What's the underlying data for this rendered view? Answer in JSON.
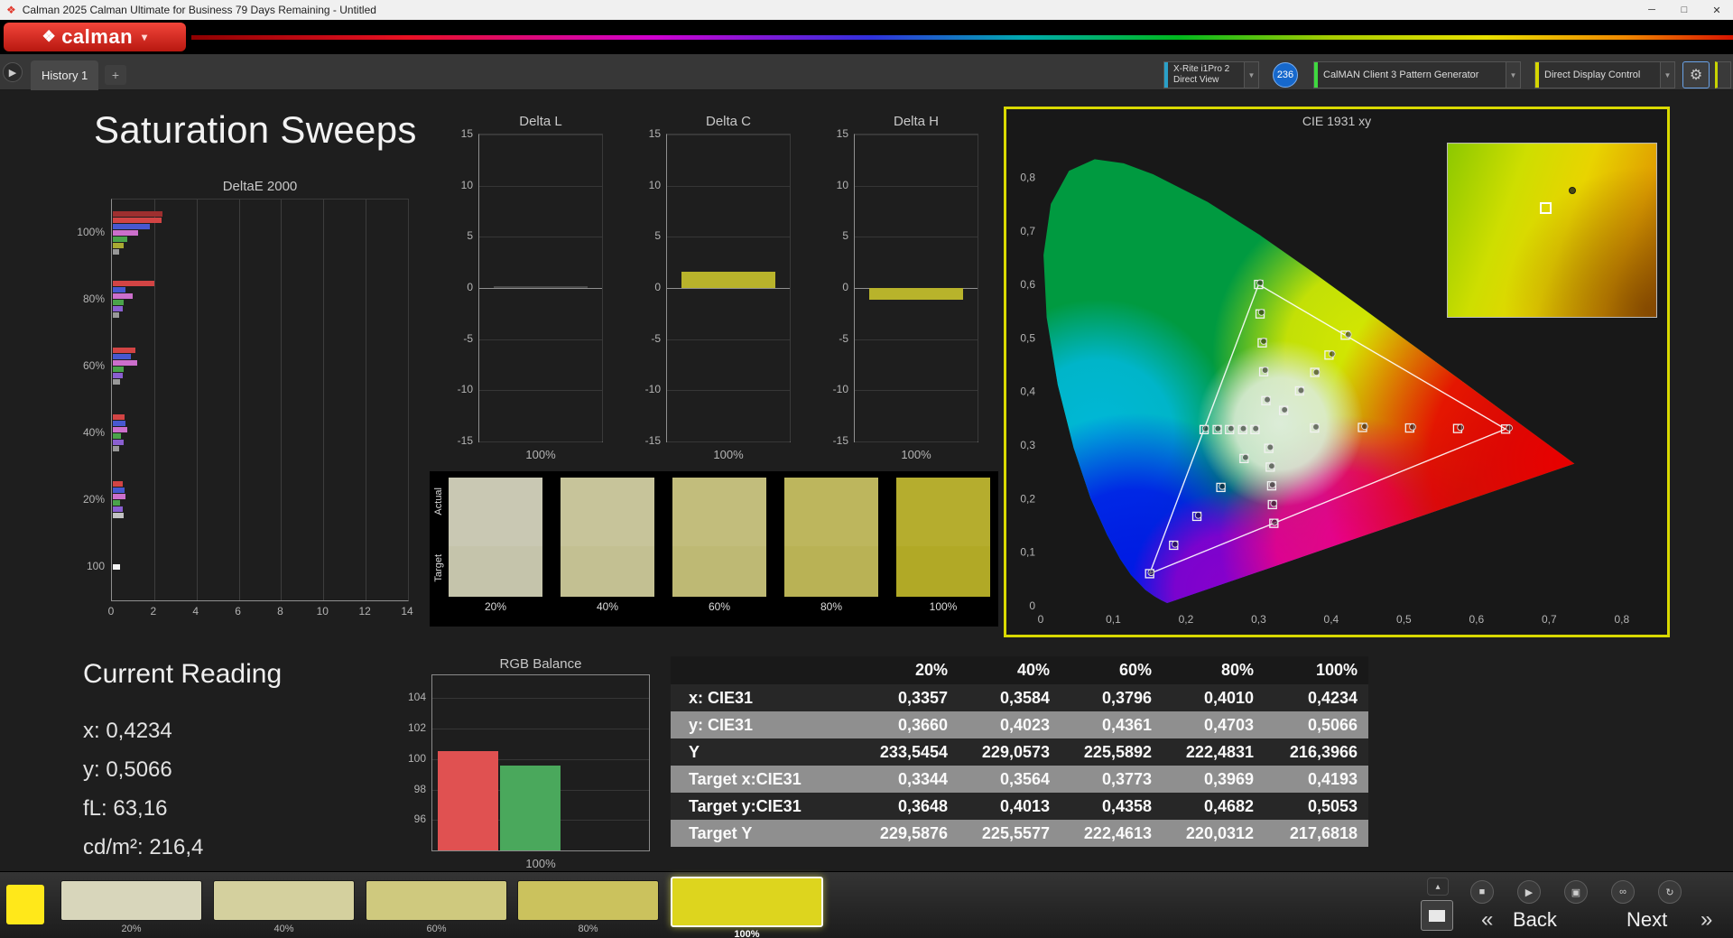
{
  "window": {
    "title": "Calman 2025 Calman Ultimate for Business 79 Days Remaining  - Untitled",
    "controls": {
      "minimize": "─",
      "maximize": "□",
      "close": "✕"
    }
  },
  "brand": {
    "logo_text": "calman",
    "logo_mark": "❖"
  },
  "tab_bar": {
    "tabs": [
      {
        "label": "History 1"
      }
    ],
    "add_label": "+",
    "scroll_label": "▶",
    "meter_dropdown": {
      "line1": "X-Rite i1Pro 2",
      "line2": "Direct View"
    },
    "badge": "236",
    "source_dropdown": "CalMAN Client 3 Pattern Generator",
    "display_dropdown": "Direct Display Control",
    "gear_label": "⚙"
  },
  "page": {
    "title": "Saturation Sweeps"
  },
  "current_reading": {
    "title": "Current Reading",
    "x": "x: 0,4234",
    "y": "y: 0,5066",
    "fl": "fL: 63,16",
    "cdm2": "cd/m²: 216,4"
  },
  "swatch_panel": {
    "row_labels": [
      "Actual",
      "Target"
    ],
    "columns": [
      {
        "label": "20%",
        "actual": "#c9c8b3",
        "target": "#c5c4ab"
      },
      {
        "label": "40%",
        "actual": "#c7c49a",
        "target": "#c3c092"
      },
      {
        "label": "60%",
        "actual": "#c2bd7c",
        "target": "#beb974"
      },
      {
        "label": "80%",
        "actual": "#bdb65d",
        "target": "#b9b255"
      },
      {
        "label": "100%",
        "actual": "#b5ad2e",
        "target": "#b1a926"
      }
    ]
  },
  "table": {
    "headers": [
      "",
      "20%",
      "40%",
      "60%",
      "80%",
      "100%"
    ],
    "rows": [
      {
        "label": "x: CIE31",
        "values": [
          "0,3357",
          "0,3584",
          "0,3796",
          "0,4010",
          "0,4234"
        ]
      },
      {
        "label": "y: CIE31",
        "values": [
          "0,3660",
          "0,4023",
          "0,4361",
          "0,4703",
          "0,5066"
        ]
      },
      {
        "label": "Y",
        "values": [
          "233,5454",
          "229,0573",
          "225,5892",
          "222,4831",
          "216,3966"
        ]
      },
      {
        "label": "Target x:CIE31",
        "values": [
          "0,3344",
          "0,3564",
          "0,3773",
          "0,3969",
          "0,4193"
        ]
      },
      {
        "label": "Target y:CIE31",
        "values": [
          "0,3648",
          "0,4013",
          "0,4358",
          "0,4682",
          "0,5053"
        ]
      },
      {
        "label": "Target Y",
        "values": [
          "229,5876",
          "225,5577",
          "222,4613",
          "220,0312",
          "217,6818"
        ]
      }
    ]
  },
  "bottom_bar": {
    "preview_color": "#ffe81a",
    "swatches": [
      {
        "label": "20%",
        "color": "#d8d6bb",
        "selected": false
      },
      {
        "label": "40%",
        "color": "#d4d09e",
        "selected": false
      },
      {
        "label": "60%",
        "color": "#cfc97e",
        "selected": false
      },
      {
        "label": "80%",
        "color": "#cbc25d",
        "selected": false
      },
      {
        "label": "100%",
        "color": "#ddd51e",
        "selected": true
      }
    ],
    "transport": {
      "eject": "▴",
      "stop": "■",
      "play": "▶",
      "save": "▣",
      "link": "∞",
      "refresh": "↻"
    },
    "back_chevron": "«",
    "back_label": "Back",
    "next_label": "Next",
    "next_chevron": "»"
  },
  "chart_data": [
    {
      "id": "delta_e",
      "type": "bar",
      "orientation": "horizontal",
      "title": "DeltaE 2000",
      "xlim": [
        0,
        14
      ],
      "x_ticks": [
        0,
        2,
        4,
        6,
        8,
        10,
        12,
        14
      ],
      "groups": [
        {
          "label": "100%",
          "bars": [
            {
              "c": "#9e2f2f",
              "v": 2.35
            },
            {
              "c": "#d24444",
              "v": 2.3
            },
            {
              "c": "#4758d0",
              "v": 1.75
            },
            {
              "c": "#cc6fcc",
              "v": 1.2
            },
            {
              "c": "#4aa34a",
              "v": 0.7
            },
            {
              "c": "#a9a932",
              "v": 0.5
            },
            {
              "c": "#989898",
              "v": 0.3
            }
          ]
        },
        {
          "label": "80%",
          "bars": [
            {
              "c": "#d24444",
              "v": 1.95
            },
            {
              "c": "#4758d0",
              "v": 0.6
            },
            {
              "c": "#cc6fcc",
              "v": 0.95
            },
            {
              "c": "#4aa34a",
              "v": 0.5
            },
            {
              "c": "#8a5fd0",
              "v": 0.45
            },
            {
              "c": "#989898",
              "v": 0.3
            }
          ]
        },
        {
          "label": "60%",
          "bars": [
            {
              "c": "#d24444",
              "v": 1.05
            },
            {
              "c": "#4758d0",
              "v": 0.85
            },
            {
              "c": "#cc6fcc",
              "v": 1.15
            },
            {
              "c": "#4aa34a",
              "v": 0.5
            },
            {
              "c": "#8a5fd0",
              "v": 0.45
            },
            {
              "c": "#989898",
              "v": 0.35
            }
          ]
        },
        {
          "label": "40%",
          "bars": [
            {
              "c": "#d24444",
              "v": 0.55
            },
            {
              "c": "#4758d0",
              "v": 0.6
            },
            {
              "c": "#cc6fcc",
              "v": 0.7
            },
            {
              "c": "#4aa34a",
              "v": 0.4
            },
            {
              "c": "#8a5fd0",
              "v": 0.5
            },
            {
              "c": "#989898",
              "v": 0.3
            }
          ]
        },
        {
          "label": "20%",
          "bars": [
            {
              "c": "#d24444",
              "v": 0.45
            },
            {
              "c": "#4758d0",
              "v": 0.55
            },
            {
              "c": "#cc6fcc",
              "v": 0.6
            },
            {
              "c": "#4aa34a",
              "v": 0.35
            },
            {
              "c": "#8a5fd0",
              "v": 0.45
            },
            {
              "c": "#c2c2c2",
              "v": 0.5
            }
          ]
        },
        {
          "label": "100",
          "bars": [
            {
              "c": "#f5f5f5",
              "v": 0.35
            }
          ]
        }
      ]
    },
    {
      "id": "delta_l",
      "type": "bar",
      "title": "Delta L",
      "ylim": [
        -15,
        15
      ],
      "y_ticks": [
        15,
        10,
        5,
        0,
        -5,
        -10,
        -15
      ],
      "xlabel": "100%",
      "value": 0.15,
      "color": "#4a4a4a"
    },
    {
      "id": "delta_c",
      "type": "bar",
      "title": "Delta C",
      "ylim": [
        -15,
        15
      ],
      "y_ticks": [
        15,
        10,
        5,
        0,
        -5,
        -10,
        -15
      ],
      "xlabel": "100%",
      "value": 1.6,
      "color": "#b8b32b"
    },
    {
      "id": "delta_h",
      "type": "bar",
      "title": "Delta H",
      "ylim": [
        -15,
        15
      ],
      "y_ticks": [
        15,
        10,
        5,
        0,
        -5,
        -10,
        -15
      ],
      "xlabel": "100%",
      "value": -1.15,
      "color": "#b8b32b"
    },
    {
      "id": "rgb_balance",
      "type": "bar",
      "title": "RGB Balance",
      "ylim": [
        94,
        105.5
      ],
      "y_ticks": [
        104,
        102,
        100,
        98,
        96
      ],
      "xlabel": "100%",
      "series": [
        {
          "name": "Red",
          "color": "#e05151",
          "value": 100.55
        },
        {
          "name": "Green",
          "color": "#4aa85c",
          "value": 99.6
        }
      ]
    },
    {
      "id": "cie",
      "type": "scatter",
      "title": "CIE 1931 xy",
      "xlim": [
        0,
        0.84
      ],
      "ylim": [
        0,
        0.88
      ],
      "x_ticks": [
        "0",
        "0,1",
        "0,2",
        "0,3",
        "0,4",
        "0,5",
        "0,6",
        "0,7",
        "0,8"
      ],
      "y_ticks": [
        "0,8",
        "0,7",
        "0,6",
        "0,5",
        "0,4",
        "0,3",
        "0,2",
        "0,1",
        "0"
      ],
      "gamut_triangle": [
        [
          0.64,
          0.33
        ],
        [
          0.3,
          0.6
        ],
        [
          0.15,
          0.06
        ]
      ],
      "targets": [
        [
          0.377,
          0.332
        ],
        [
          0.443,
          0.333
        ],
        [
          0.508,
          0.332
        ],
        [
          0.574,
          0.331
        ],
        [
          0.64,
          0.33
        ],
        [
          0.31,
          0.383
        ],
        [
          0.307,
          0.437
        ],
        [
          0.305,
          0.491
        ],
        [
          0.302,
          0.545
        ],
        [
          0.3,
          0.6
        ],
        [
          0.28,
          0.275
        ],
        [
          0.248,
          0.221
        ],
        [
          0.215,
          0.167
        ],
        [
          0.183,
          0.113
        ],
        [
          0.15,
          0.06
        ],
        [
          0.3344,
          0.3648
        ],
        [
          0.3564,
          0.4013
        ],
        [
          0.3773,
          0.4358
        ],
        [
          0.3969,
          0.4682
        ],
        [
          0.4193,
          0.5053
        ],
        [
          0.295,
          0.329
        ],
        [
          0.278,
          0.329
        ],
        [
          0.26,
          0.329
        ],
        [
          0.243,
          0.329
        ],
        [
          0.225,
          0.329
        ],
        [
          0.314,
          0.294
        ],
        [
          0.316,
          0.259
        ],
        [
          0.318,
          0.224
        ],
        [
          0.319,
          0.189
        ],
        [
          0.321,
          0.154
        ]
      ],
      "measured": [
        [
          0.379,
          0.334
        ],
        [
          0.446,
          0.335
        ],
        [
          0.512,
          0.334
        ],
        [
          0.578,
          0.333
        ],
        [
          0.645,
          0.332
        ],
        [
          0.312,
          0.385
        ],
        [
          0.309,
          0.44
        ],
        [
          0.307,
          0.494
        ],
        [
          0.304,
          0.548
        ],
        [
          0.302,
          0.603
        ],
        [
          0.282,
          0.277
        ],
        [
          0.25,
          0.223
        ],
        [
          0.217,
          0.169
        ],
        [
          0.185,
          0.115
        ],
        [
          0.152,
          0.062
        ],
        [
          0.3357,
          0.366
        ],
        [
          0.3584,
          0.4023
        ],
        [
          0.3796,
          0.4361
        ],
        [
          0.401,
          0.4703
        ],
        [
          0.4234,
          0.5066
        ],
        [
          0.296,
          0.331
        ],
        [
          0.279,
          0.331
        ],
        [
          0.262,
          0.331
        ],
        [
          0.244,
          0.331
        ],
        [
          0.227,
          0.331
        ],
        [
          0.316,
          0.296
        ],
        [
          0.318,
          0.261
        ],
        [
          0.319,
          0.226
        ],
        [
          0.321,
          0.191
        ],
        [
          0.322,
          0.156
        ]
      ]
    }
  ]
}
